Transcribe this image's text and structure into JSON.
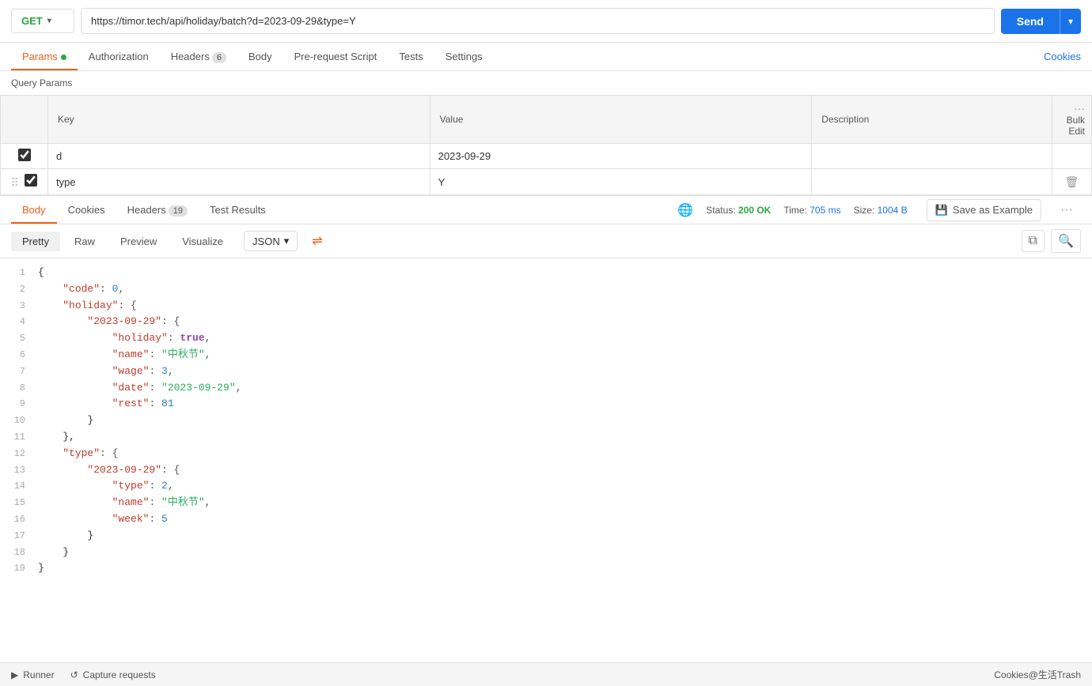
{
  "urlBar": {
    "method": "GET",
    "url": "https://timor.tech/api/holiday/batch?d=2023-09-29&type=Y",
    "sendLabel": "Send"
  },
  "requestTabs": {
    "items": [
      {
        "id": "params",
        "label": "Params",
        "dot": true,
        "active": true
      },
      {
        "id": "authorization",
        "label": "Authorization"
      },
      {
        "id": "headers",
        "label": "Headers",
        "badge": "6"
      },
      {
        "id": "body",
        "label": "Body"
      },
      {
        "id": "prerequest",
        "label": "Pre-request Script"
      },
      {
        "id": "tests",
        "label": "Tests"
      },
      {
        "id": "settings",
        "label": "Settings"
      }
    ],
    "cookiesLabel": "Cookies"
  },
  "queryParams": {
    "label": "Query Params",
    "columns": [
      "Key",
      "Value",
      "Description"
    ],
    "bulkEditLabel": "Bulk Edit",
    "rows": [
      {
        "checked": true,
        "key": "d",
        "value": "2023-09-29",
        "description": ""
      },
      {
        "checked": true,
        "key": "type",
        "value": "Y",
        "description": ""
      }
    ]
  },
  "responseTabs": {
    "items": [
      {
        "id": "body",
        "label": "Body",
        "active": true
      },
      {
        "id": "cookies",
        "label": "Cookies"
      },
      {
        "id": "headers",
        "label": "Headers",
        "badge": "19"
      },
      {
        "id": "testresults",
        "label": "Test Results"
      }
    ],
    "status": "200 OK",
    "time": "705 ms",
    "size": "1004 B",
    "saveExampleLabel": "Save as Example"
  },
  "bodyView": {
    "tabs": [
      "Pretty",
      "Raw",
      "Preview",
      "Visualize"
    ],
    "activeTab": "Pretty",
    "format": "JSON"
  },
  "jsonLines": [
    {
      "num": 1,
      "tokens": [
        {
          "t": "brace",
          "v": "{"
        }
      ]
    },
    {
      "num": 2,
      "tokens": [
        {
          "t": "indent",
          "v": "    "
        },
        {
          "t": "key",
          "v": "\"code\""
        },
        {
          "t": "punct",
          "v": ": "
        },
        {
          "t": "num",
          "v": "0"
        },
        {
          "t": "punct",
          "v": ","
        }
      ]
    },
    {
      "num": 3,
      "tokens": [
        {
          "t": "indent",
          "v": "    "
        },
        {
          "t": "key",
          "v": "\"holiday\""
        },
        {
          "t": "punct",
          "v": ": {"
        }
      ]
    },
    {
      "num": 4,
      "tokens": [
        {
          "t": "indent",
          "v": "        "
        },
        {
          "t": "key",
          "v": "\"2023-09-29\""
        },
        {
          "t": "punct",
          "v": ": {"
        }
      ]
    },
    {
      "num": 5,
      "tokens": [
        {
          "t": "indent",
          "v": "            "
        },
        {
          "t": "key",
          "v": "\"holiday\""
        },
        {
          "t": "punct",
          "v": ": "
        },
        {
          "t": "bool",
          "v": "true"
        },
        {
          "t": "punct",
          "v": ","
        }
      ]
    },
    {
      "num": 6,
      "tokens": [
        {
          "t": "indent",
          "v": "            "
        },
        {
          "t": "key",
          "v": "\"name\""
        },
        {
          "t": "punct",
          "v": ": "
        },
        {
          "t": "str",
          "v": "\"中秋节\""
        },
        {
          "t": "punct",
          "v": ","
        }
      ]
    },
    {
      "num": 7,
      "tokens": [
        {
          "t": "indent",
          "v": "            "
        },
        {
          "t": "key",
          "v": "\"wage\""
        },
        {
          "t": "punct",
          "v": ": "
        },
        {
          "t": "num",
          "v": "3"
        },
        {
          "t": "punct",
          "v": ","
        }
      ]
    },
    {
      "num": 8,
      "tokens": [
        {
          "t": "indent",
          "v": "            "
        },
        {
          "t": "key",
          "v": "\"date\""
        },
        {
          "t": "punct",
          "v": ": "
        },
        {
          "t": "str",
          "v": "\"2023-09-29\""
        },
        {
          "t": "punct",
          "v": ","
        }
      ]
    },
    {
      "num": 9,
      "tokens": [
        {
          "t": "indent",
          "v": "            "
        },
        {
          "t": "key",
          "v": "\"rest\""
        },
        {
          "t": "punct",
          "v": ": "
        },
        {
          "t": "num",
          "v": "81"
        }
      ]
    },
    {
      "num": 10,
      "tokens": [
        {
          "t": "indent",
          "v": "        "
        },
        {
          "t": "brace",
          "v": "}"
        }
      ]
    },
    {
      "num": 11,
      "tokens": [
        {
          "t": "indent",
          "v": "    "
        },
        {
          "t": "brace",
          "v": "},"
        }
      ]
    },
    {
      "num": 12,
      "tokens": [
        {
          "t": "indent",
          "v": "    "
        },
        {
          "t": "key",
          "v": "\"type\""
        },
        {
          "t": "punct",
          "v": ": {"
        }
      ]
    },
    {
      "num": 13,
      "tokens": [
        {
          "t": "indent",
          "v": "        "
        },
        {
          "t": "key",
          "v": "\"2023-09-29\""
        },
        {
          "t": "punct",
          "v": ": {"
        }
      ]
    },
    {
      "num": 14,
      "tokens": [
        {
          "t": "indent",
          "v": "            "
        },
        {
          "t": "key",
          "v": "\"type\""
        },
        {
          "t": "punct",
          "v": ": "
        },
        {
          "t": "num",
          "v": "2"
        },
        {
          "t": "punct",
          "v": ","
        }
      ]
    },
    {
      "num": 15,
      "tokens": [
        {
          "t": "indent",
          "v": "            "
        },
        {
          "t": "key",
          "v": "\"name\""
        },
        {
          "t": "punct",
          "v": ": "
        },
        {
          "t": "str",
          "v": "\"中秋节\""
        },
        {
          "t": "punct",
          "v": ","
        }
      ]
    },
    {
      "num": 16,
      "tokens": [
        {
          "t": "indent",
          "v": "            "
        },
        {
          "t": "key",
          "v": "\"week\""
        },
        {
          "t": "punct",
          "v": ": "
        },
        {
          "t": "num",
          "v": "5"
        }
      ]
    },
    {
      "num": 17,
      "tokens": [
        {
          "t": "indent",
          "v": "        "
        },
        {
          "t": "brace",
          "v": "}"
        }
      ]
    },
    {
      "num": 18,
      "tokens": [
        {
          "t": "indent",
          "v": "    "
        },
        {
          "t": "brace",
          "v": "}"
        }
      ]
    },
    {
      "num": 19,
      "tokens": [
        {
          "t": "brace",
          "v": "}"
        }
      ]
    }
  ],
  "bottomBar": {
    "runnerLabel": "Runner",
    "captureLabel": "Capture requests",
    "rightText": "Cookies@生活Trash"
  }
}
